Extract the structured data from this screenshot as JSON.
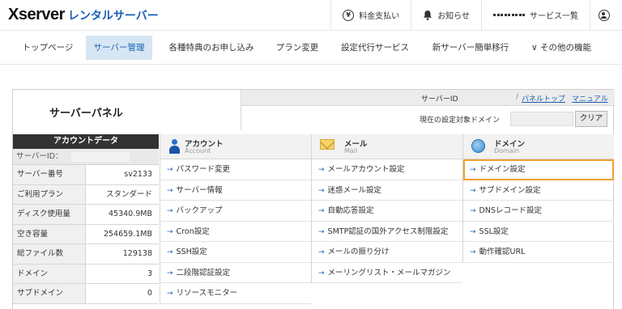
{
  "header": {
    "logo_main": "Xserver",
    "logo_sub": "レンタルサーバー",
    "actions": [
      {
        "label": "料金支払い",
        "icon": "yen-icon"
      },
      {
        "label": "お知らせ",
        "icon": "bell-icon"
      },
      {
        "label": "サービス一覧",
        "icon": "grid-icon"
      },
      {
        "label": "",
        "icon": "user-icon"
      }
    ]
  },
  "nav": {
    "items": [
      {
        "label": "トップページ"
      },
      {
        "label": "サーバー管理",
        "active": true
      },
      {
        "label": "各種特典のお申し込み"
      },
      {
        "label": "プラン変更"
      },
      {
        "label": "設定代行サービス"
      },
      {
        "label": "新サーバー簡単移行"
      },
      {
        "label": "その他の機能",
        "prefix": "∨"
      }
    ]
  },
  "panel": {
    "title": "サーバーパネル",
    "server_id_label": "サーバーID",
    "slash": "/",
    "link_top": "パネルトップ",
    "link_manual": "マニュアル",
    "current_domain_label": "現在の設定対象ドメイン",
    "clear_button": "クリア"
  },
  "account": {
    "header": "アカウントデータ",
    "server_id_label": "サーバーID：",
    "rows": [
      {
        "key": "サーバー番号",
        "value": "sv2133"
      },
      {
        "key": "ご利用プラン",
        "value": "スタンダード"
      },
      {
        "key": "ディスク使用量",
        "value": "45340.9MB"
      },
      {
        "key": "空き容量",
        "value": "254659.1MB"
      },
      {
        "key": "総ファイル数",
        "value": "129138"
      },
      {
        "key": "ドメイン",
        "value": "3"
      },
      {
        "key": "サブドメイン",
        "value": "0"
      }
    ]
  },
  "columns": {
    "account": {
      "title": "アカウント",
      "subtitle": "Account",
      "items": [
        "パスワード変更",
        "サーバー情報",
        "バックアップ",
        "Cron設定",
        "SSH設定",
        "二段階認証設定",
        "リソースモニター"
      ]
    },
    "mail": {
      "title": "メール",
      "subtitle": "Mail",
      "items": [
        "メールアカウント設定",
        "迷惑メール設定",
        "自動応答設定",
        "SMTP認証の国外アクセス制限設定",
        "メールの振り分け",
        "メーリングリスト・メールマガジン"
      ]
    },
    "domain": {
      "title": "ドメイン",
      "subtitle": "Domain",
      "items": [
        "ドメイン設定",
        "サブドメイン設定",
        "DNSレコード設定",
        "SSL設定",
        "動作確認URL"
      ]
    }
  },
  "arrow_glyph": "→",
  "colors": {
    "accent": "#1a5fb4",
    "highlight": "#f0a030",
    "header_dark": "#333333",
    "nav_active": "#d6e6f4"
  }
}
